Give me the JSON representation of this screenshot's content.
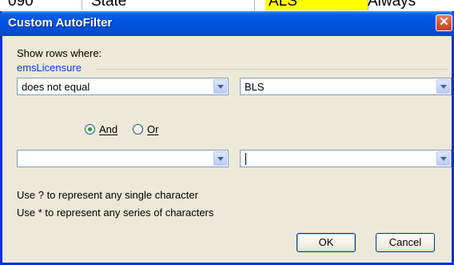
{
  "sheet": {
    "cell1": "090",
    "cell2": "State",
    "cell3": "ALS",
    "cell4": "Always"
  },
  "dialog": {
    "title": "Custom AutoFilter",
    "close_label": "✕",
    "show_rows_label": "Show rows where:",
    "field_name": "emsLicensure",
    "row1": {
      "operator": "does not equal",
      "value": "BLS"
    },
    "row2": {
      "operator": "",
      "value": ""
    },
    "and_label": "And",
    "or_label": "Or",
    "selected_logic": "And",
    "hint_single": "Use ? to represent any single character",
    "hint_series": "Use * to represent any series of characters",
    "ok_label": "OK",
    "cancel_label": "Cancel"
  },
  "colors": {
    "title_bar": "#0054e3",
    "field_name": "#0046d5",
    "highlight_cell": "#ffff00"
  }
}
